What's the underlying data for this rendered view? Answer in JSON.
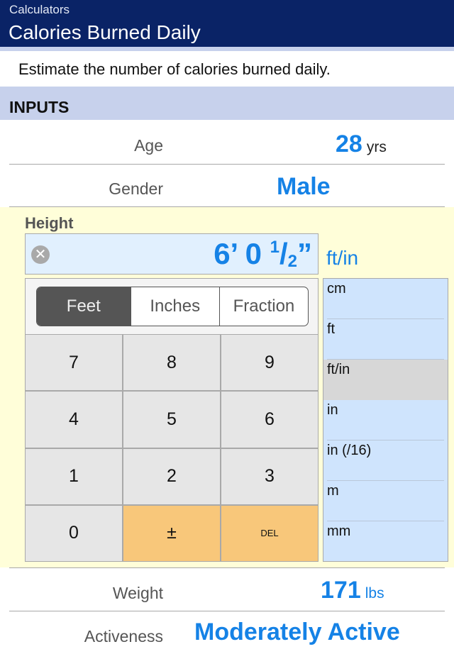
{
  "navbar": {
    "breadcrumb": "Calculators",
    "title": "Calories Burned Daily"
  },
  "description": "Estimate the number of calories burned daily.",
  "section_header": "INPUTS",
  "inputs": {
    "age": {
      "label": "Age",
      "value": "28",
      "unit": "yrs"
    },
    "gender": {
      "label": "Gender",
      "value": "Male"
    },
    "height": {
      "label": "Height",
      "value_feet": "6’",
      "value_inches": "0",
      "fraction_num": "1",
      "fraction_den": "2",
      "inch_mark": "”",
      "unit": "ft/in",
      "segments": [
        "Feet",
        "Inches",
        "Fraction"
      ],
      "active_segment": "Feet",
      "keys": [
        "7",
        "8",
        "9",
        "4",
        "5",
        "6",
        "1",
        "2",
        "3",
        "0",
        "±",
        "DEL"
      ],
      "unit_options": [
        "cm",
        "ft",
        "ft/in",
        "in",
        "in (/16)",
        "m",
        "mm"
      ],
      "selected_unit": "ft/in"
    },
    "weight": {
      "label": "Weight",
      "value": "171",
      "unit": "lbs"
    },
    "activeness": {
      "label": "Activeness",
      "value": "Moderately Active"
    }
  },
  "colors": {
    "navbar": "#0a2366",
    "accent": "#1582e6",
    "section": "#c7d1ec",
    "panel": "#fffed9",
    "key_orange": "#f8c77a"
  }
}
